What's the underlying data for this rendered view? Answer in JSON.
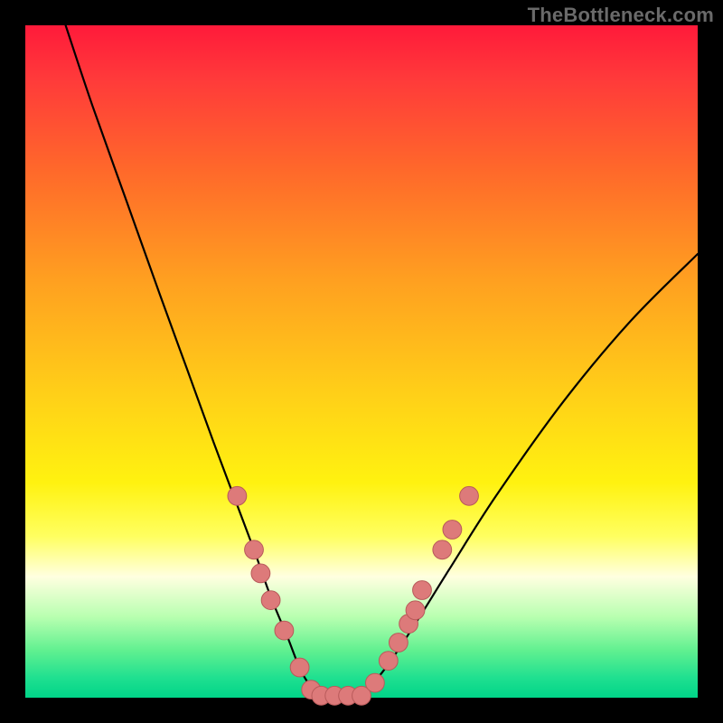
{
  "watermark": "TheBottleneck.com",
  "chart_data": {
    "type": "line",
    "title": "",
    "xlabel": "",
    "ylabel": "",
    "xlim": [
      0,
      100
    ],
    "ylim": [
      0,
      100
    ],
    "grid": false,
    "series": [
      {
        "name": "bottleneck-curve",
        "x": [
          6,
          10,
          15,
          20,
          24,
          28,
          31,
          34,
          36.5,
          39,
          41,
          43,
          44.5,
          46,
          48,
          51,
          54,
          58,
          63,
          70,
          80,
          90,
          100
        ],
        "y": [
          100,
          88,
          74,
          60,
          49,
          38,
          30,
          22,
          15,
          9,
          4,
          1,
          0,
          0,
          0,
          1.5,
          5,
          11,
          19,
          30,
          44,
          56,
          66
        ]
      }
    ],
    "markers": [
      {
        "x": 31.5,
        "y": 30
      },
      {
        "x": 34,
        "y": 22
      },
      {
        "x": 35,
        "y": 18.5
      },
      {
        "x": 36.5,
        "y": 14.5
      },
      {
        "x": 38.5,
        "y": 10
      },
      {
        "x": 40.8,
        "y": 4.5
      },
      {
        "x": 42.5,
        "y": 1.2
      },
      {
        "x": 44,
        "y": 0.3
      },
      {
        "x": 46,
        "y": 0.3
      },
      {
        "x": 48,
        "y": 0.3
      },
      {
        "x": 50,
        "y": 0.3
      },
      {
        "x": 52,
        "y": 2.2
      },
      {
        "x": 54,
        "y": 5.5
      },
      {
        "x": 55.5,
        "y": 8.2
      },
      {
        "x": 57,
        "y": 11
      },
      {
        "x": 58,
        "y": 13
      },
      {
        "x": 59,
        "y": 16
      },
      {
        "x": 62,
        "y": 22
      },
      {
        "x": 63.5,
        "y": 25
      },
      {
        "x": 66,
        "y": 30
      }
    ],
    "marker_style": {
      "fill": "#dd7a7a",
      "stroke": "#b85a5a",
      "radius_pct": 1.4
    }
  }
}
